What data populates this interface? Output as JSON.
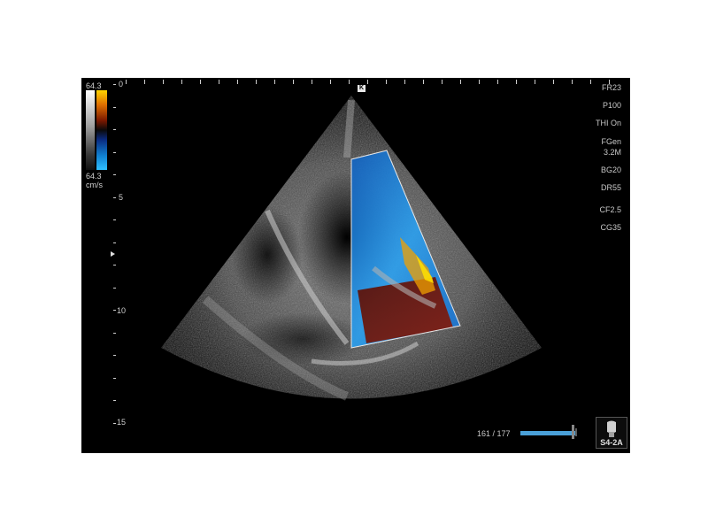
{
  "colorbar": {
    "top_value": "64.3",
    "bottom_value": "64.3",
    "unit": "cm/s"
  },
  "depth": {
    "labels": [
      "0",
      "5",
      "10",
      "15"
    ]
  },
  "orientation_marker": "K",
  "params": [
    "FR23",
    "P100",
    "THI On",
    "FGen",
    "3.2M",
    "BG20",
    "DR55",
    "CF2.5",
    "CG35"
  ],
  "cine": {
    "frame": "161 / 177",
    "frame_index": 161,
    "frame_total": 177
  },
  "probe": {
    "name": "S4-2A",
    "icon": "probe-icon"
  },
  "colors": {
    "screen_background": "#000000",
    "text": "#c8c8c8",
    "cine_bar": "#4aa0d8"
  }
}
